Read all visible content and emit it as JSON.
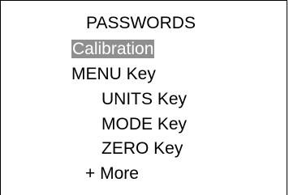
{
  "header": {
    "title": "PASSWORDS"
  },
  "menu": {
    "items": [
      {
        "label": "Calibration",
        "selected": true
      },
      {
        "label": "MENU Key",
        "selected": false
      },
      {
        "label": "UNITS Key",
        "selected": false
      },
      {
        "label": "MODE Key",
        "selected": false
      },
      {
        "label": "ZERO Key",
        "selected": false
      }
    ],
    "more_label": "+ More"
  },
  "colors": {
    "selection_bg": "#8f8f8f",
    "selection_text": "#ffffff",
    "text": "#000000",
    "background": "#ffffff"
  }
}
